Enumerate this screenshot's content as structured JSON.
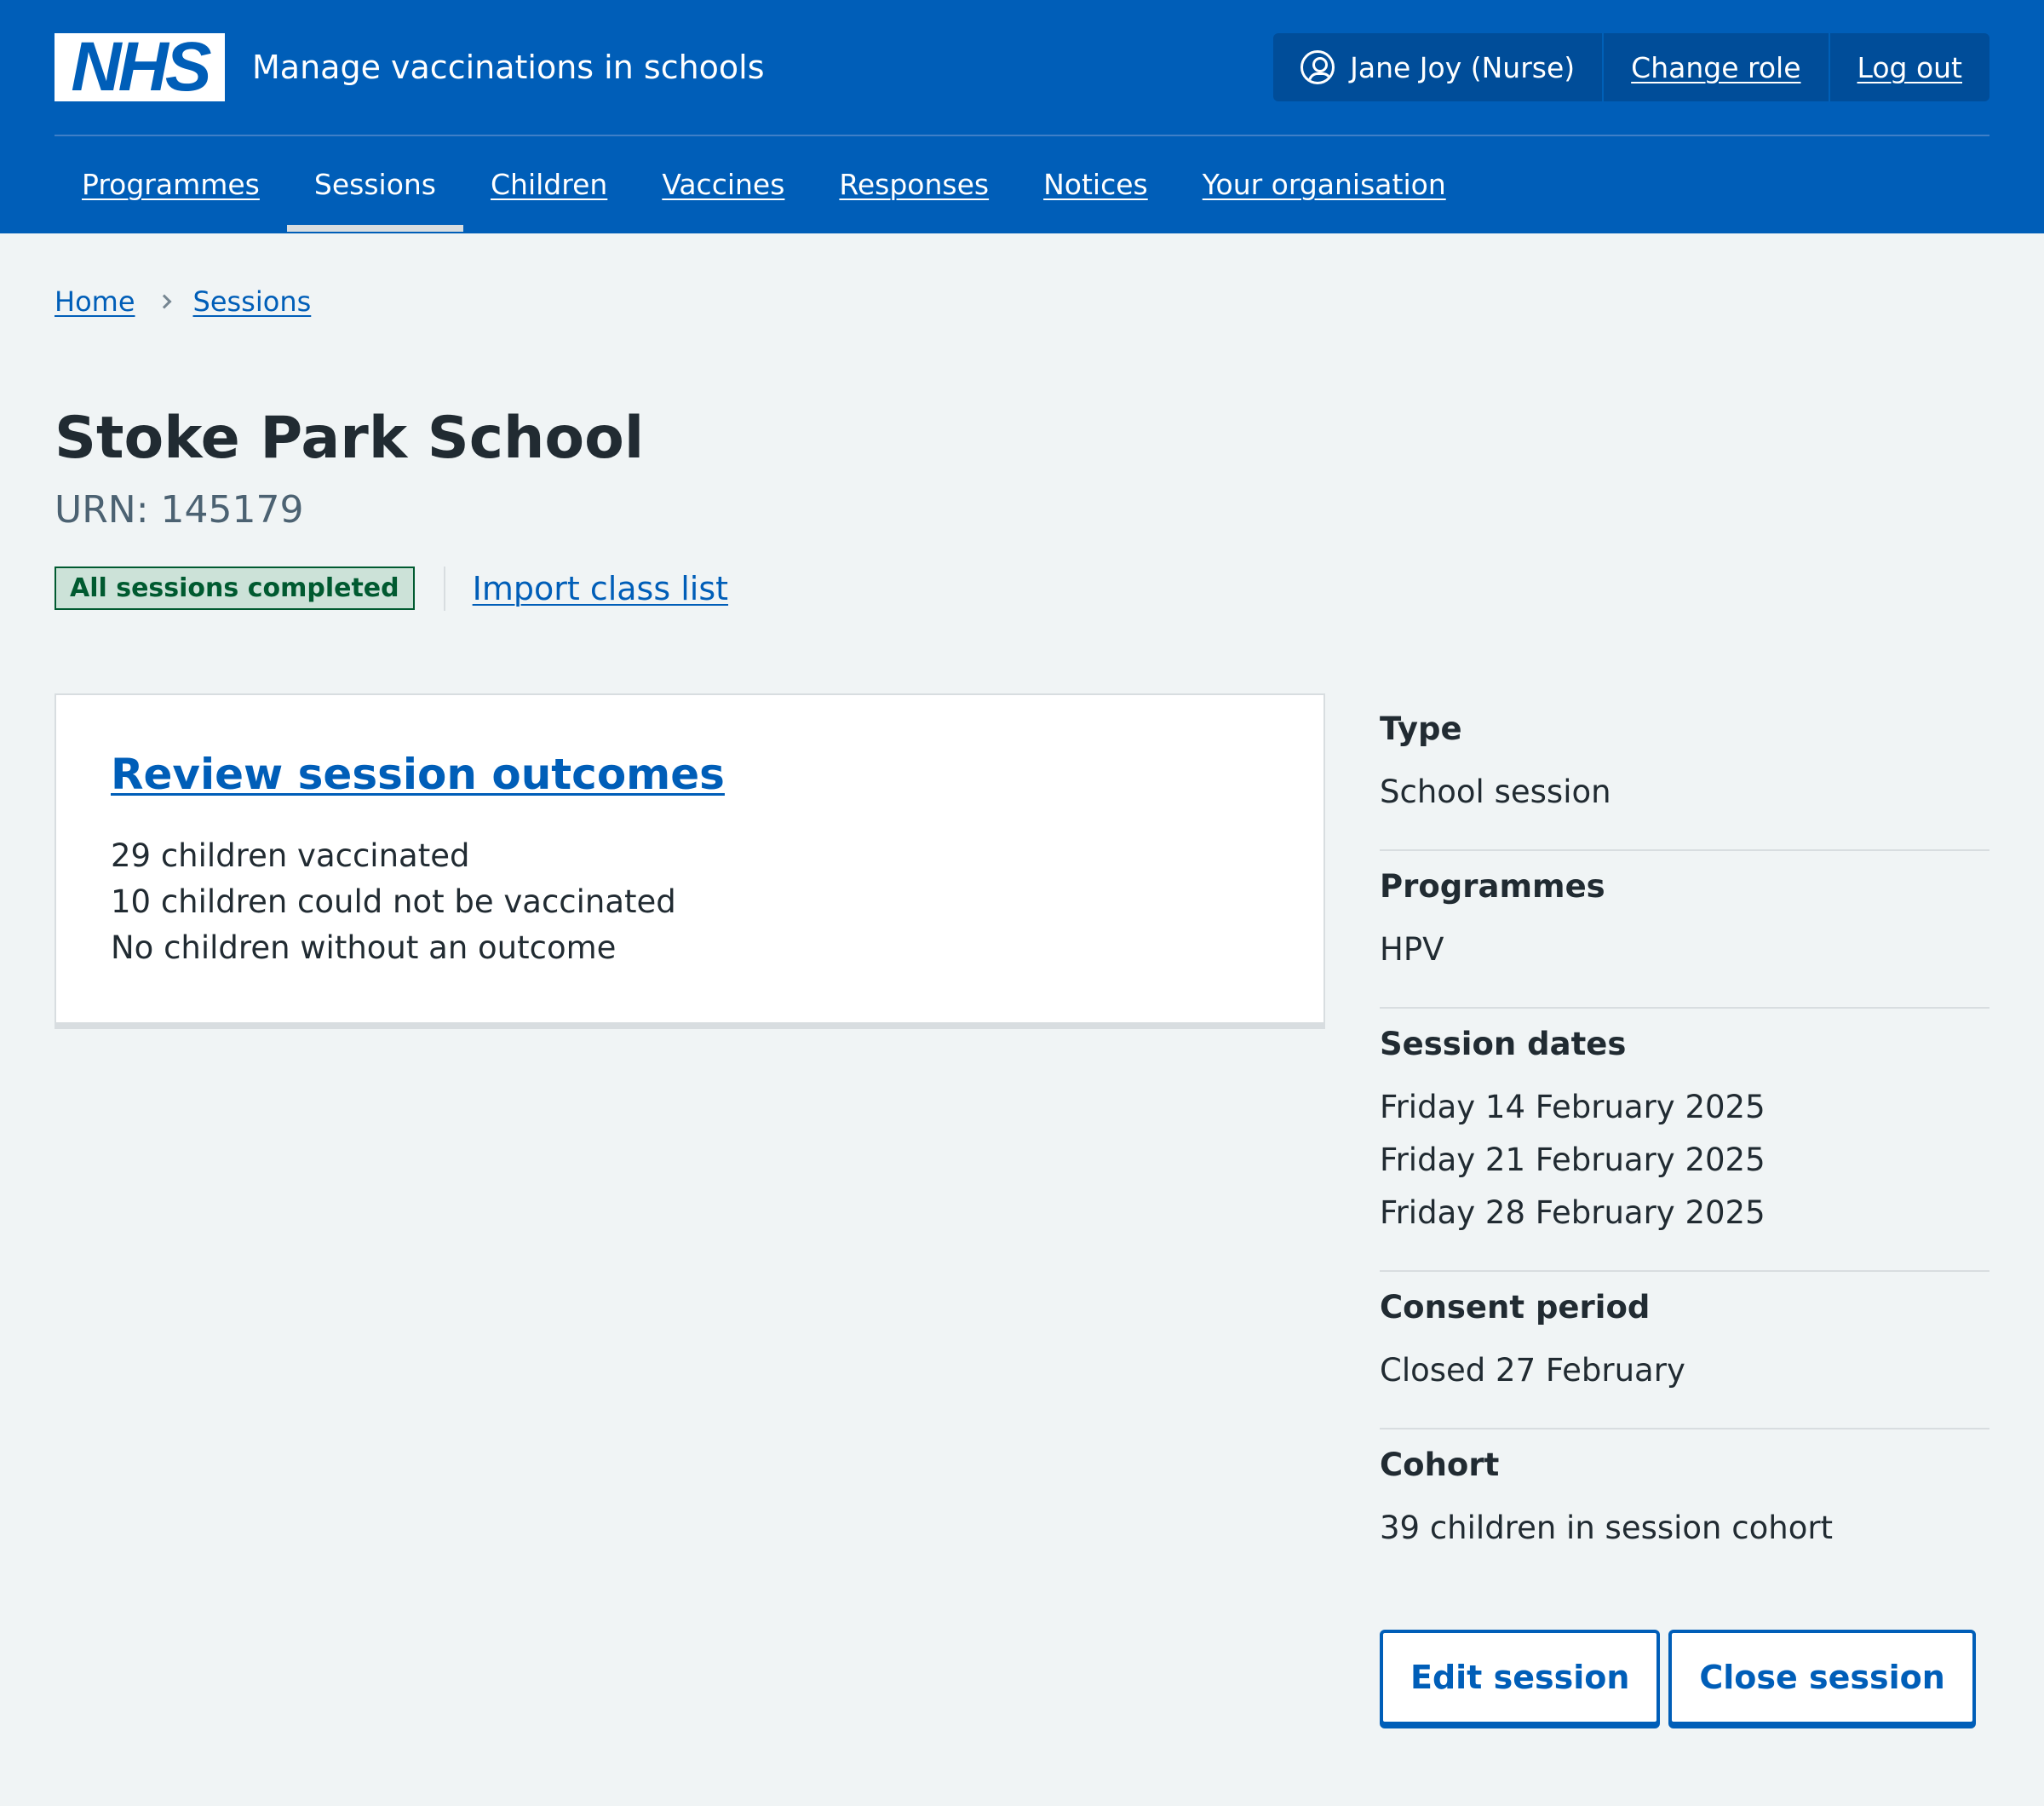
{
  "header": {
    "logo": "NHS",
    "service_name": "Manage vaccinations in schools",
    "user_name": "Jane Joy (Nurse)",
    "change_role": "Change role",
    "log_out": "Log out",
    "brand_color": "#005eb8"
  },
  "nav": {
    "items": [
      {
        "label": "Programmes",
        "active": false
      },
      {
        "label": "Sessions",
        "active": true
      },
      {
        "label": "Children",
        "active": false
      },
      {
        "label": "Vaccines",
        "active": false
      },
      {
        "label": "Responses",
        "active": false
      },
      {
        "label": "Notices",
        "active": false
      },
      {
        "label": "Your organisation",
        "active": false
      }
    ]
  },
  "breadcrumb": {
    "items": [
      "Home",
      "Sessions"
    ]
  },
  "page": {
    "title": "Stoke Park School",
    "urn": "URN: 145179",
    "status_tag": "All sessions completed",
    "import_link": "Import class list"
  },
  "card": {
    "title": "Review session outcomes",
    "lines": [
      "29 children vaccinated",
      "10 children could not be vaccinated",
      "No children without an outcome"
    ]
  },
  "summary": {
    "type": {
      "label": "Type",
      "value": "School session"
    },
    "programmes": {
      "label": "Programmes",
      "value": "HPV"
    },
    "session_dates": {
      "label": "Session dates",
      "values": [
        "Friday 14 February 2025",
        "Friday 21 February 2025",
        "Friday 28 February 2025"
      ]
    },
    "consent_period": {
      "label": "Consent period",
      "value": "Closed 27 February"
    },
    "cohort": {
      "label": "Cohort",
      "value": "39 children in session cohort"
    }
  },
  "buttons": {
    "edit": "Edit session",
    "close": "Close session"
  }
}
